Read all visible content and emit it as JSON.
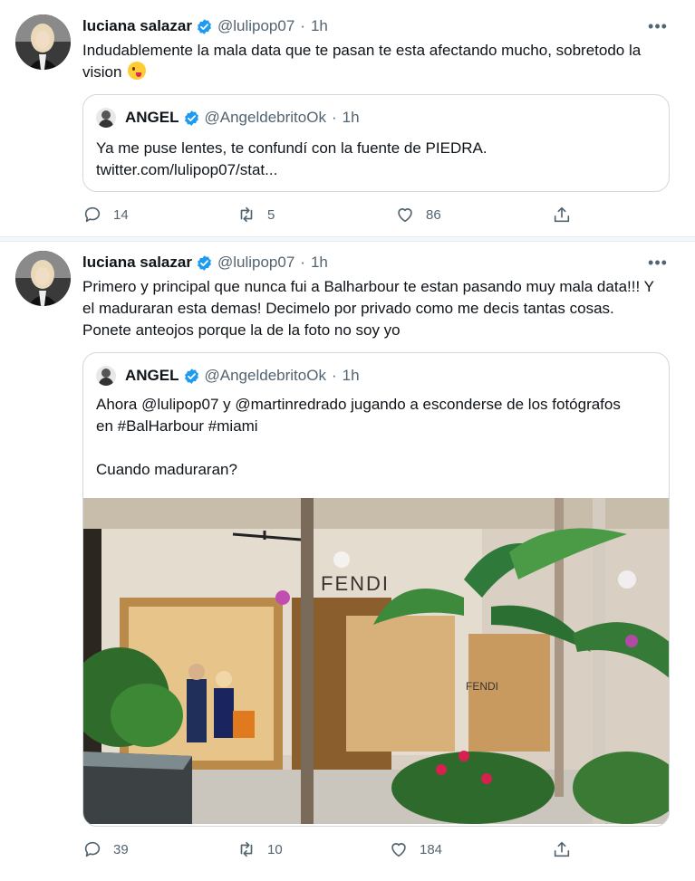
{
  "tweets": [
    {
      "author": "luciana salazar",
      "handle": "@lulipop07",
      "time": "1h",
      "text": "Indudablemente la mala data que te pasan te esta afectando mucho, sobretodo la vision",
      "emoji": "winking-face-with-tongue",
      "quote": {
        "author": "ANGEL",
        "handle": "@AngeldebritoOk",
        "time": "1h",
        "line1": "Ya me puse lentes, te confundí con la fuente de PIEDRA.",
        "line2": "twitter.com/lulipop07/stat..."
      },
      "replies": "14",
      "retweets": "5",
      "likes": "86"
    },
    {
      "author": "luciana salazar",
      "handle": "@lulipop07",
      "time": "1h",
      "text": "Primero y principal que nunca fui a Balharbour te estan pasando muy mala data!!! Y el maduraran esta demas! Decimelo por privado como me decis tantas cosas. Ponete anteojos porque la de la foto no soy yo",
      "quote": {
        "author": "ANGEL",
        "handle": "@AngeldebritoOk",
        "time": "1h",
        "line1": "Ahora @lulipop07 y @martinredrado jugando a esconderse de los fotógrafos en #BalHarbour #miami",
        "line2": "Cuando maduraran?",
        "photo_sign": "FENDI",
        "photo_sign2": "FENDI"
      },
      "replies": "39",
      "retweets": "10",
      "likes": "184"
    }
  ],
  "dot": "·",
  "more_label": "•••",
  "colors": {
    "verified": "#1d9bf0",
    "secondary": "#536471",
    "border": "#cfd9de"
  }
}
